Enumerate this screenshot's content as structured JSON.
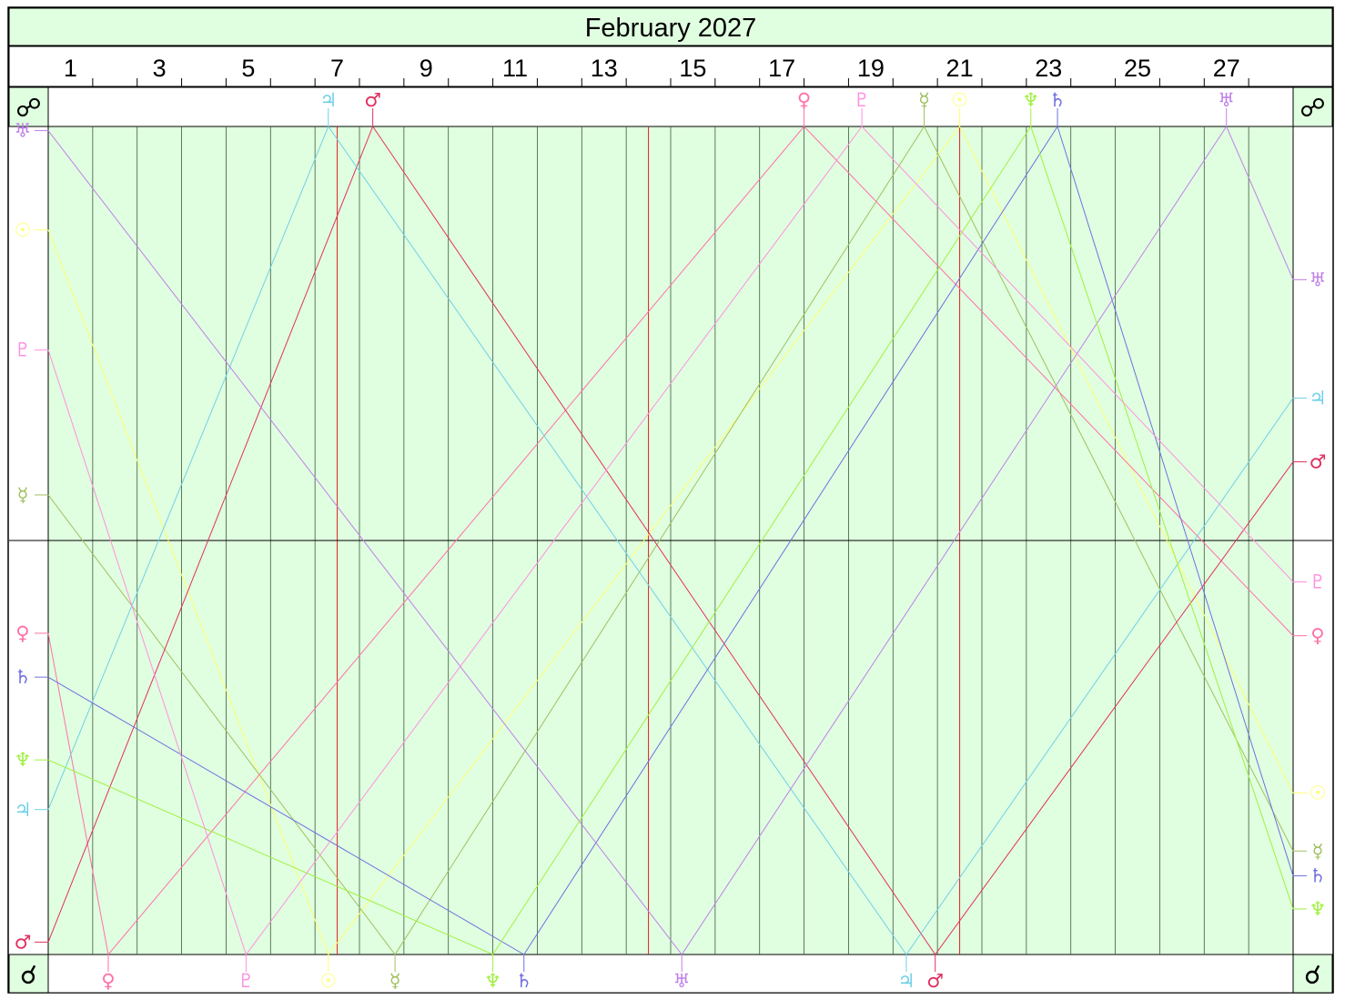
{
  "chart_data": {
    "type": "line",
    "title": "February 2027",
    "month_days": 28,
    "day_labels": [
      "1",
      "3",
      "5",
      "7",
      "9",
      "11",
      "13",
      "15",
      "17",
      "19",
      "21",
      "23",
      "25",
      "27"
    ],
    "day_label_days": [
      1,
      3,
      5,
      7,
      9,
      11,
      13,
      15,
      17,
      19,
      21,
      23,
      25,
      27
    ],
    "axis_top_aspect": "☍",
    "axis_bottom_aspect": "☌",
    "ylim": [
      0,
      1
    ],
    "y_meaning": "angular separation from opposition (top) to conjunction (bottom)",
    "red_marker_days": [
      7.0,
      14.0,
      21.0,
      28.0
    ],
    "grid": true,
    "colors": {
      "background": "#e0ffe0",
      "grid": "#3a5a3a",
      "frame": "#000000",
      "marker": "#e02020"
    },
    "series": [
      {
        "name": "Sun",
        "glyph": "☉",
        "color": "#ffff70",
        "points": [
          [
            0,
            0.875
          ],
          [
            6.3,
            0
          ],
          [
            20.5,
            1
          ],
          [
            28,
            0.195
          ]
        ]
      },
      {
        "name": "Mercury",
        "glyph": "☿",
        "color": "#a0c060",
        "points": [
          [
            0,
            0.555
          ],
          [
            7.8,
            0
          ],
          [
            19.7,
            1
          ],
          [
            28,
            0.125
          ]
        ]
      },
      {
        "name": "Venus",
        "glyph": "♀",
        "color": "#ff70a8",
        "points": [
          [
            0,
            0.388
          ],
          [
            1.35,
            0
          ],
          [
            17.0,
            1
          ],
          [
            28,
            0.385
          ]
        ]
      },
      {
        "name": "Mars",
        "glyph": "♂",
        "color": "#e03060",
        "points": [
          [
            0,
            0.015
          ],
          [
            7.3,
            1
          ],
          [
            19.95,
            0
          ],
          [
            28,
            0.595
          ]
        ]
      },
      {
        "name": "Jupiter",
        "glyph": "♃",
        "color": "#70d0e8",
        "points": [
          [
            0,
            0.175
          ],
          [
            6.3,
            1
          ],
          [
            19.3,
            0
          ],
          [
            28,
            0.672
          ]
        ]
      },
      {
        "name": "Saturn",
        "glyph": "♄",
        "color": "#7070e0",
        "points": [
          [
            0,
            0.335
          ],
          [
            10.7,
            0
          ],
          [
            22.7,
            1
          ],
          [
            28,
            0.095
          ]
        ]
      },
      {
        "name": "Uranus",
        "glyph": "♅",
        "color": "#c080e8",
        "points": [
          [
            0,
            0.995
          ],
          [
            14.25,
            0
          ],
          [
            26.5,
            1
          ],
          [
            28,
            0.815
          ]
        ]
      },
      {
        "name": "Neptune",
        "glyph": "♆",
        "color": "#a0f040",
        "points": [
          [
            0,
            0.235
          ],
          [
            10.0,
            0
          ],
          [
            22.1,
            1
          ],
          [
            28,
            0.055
          ]
        ]
      },
      {
        "name": "Pluto",
        "glyph": "♇",
        "color": "#ff90e0",
        "points": [
          [
            0,
            0.73
          ],
          [
            4.45,
            0
          ],
          [
            18.3,
            1
          ],
          [
            28,
            0.45
          ]
        ]
      }
    ]
  }
}
